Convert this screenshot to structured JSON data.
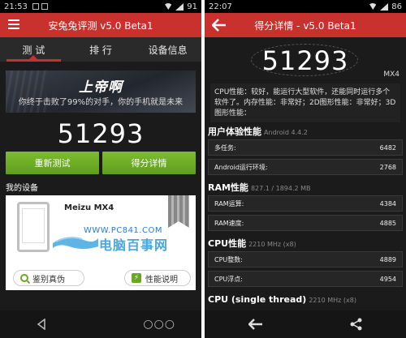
{
  "left": {
    "status": {
      "time": "21:53",
      "battery": "91"
    },
    "title": "安兔兔评测 v5.0 Beta1",
    "tabs": [
      "测 试",
      "排 行",
      "设备信息"
    ],
    "banner_title": "上帝啊",
    "banner_sub": "你终于击败了99%的对手，你的手机就是未来",
    "score": "51293",
    "retest_label": "重新测试",
    "details_label": "得分详情",
    "my_device_label": "我的设备",
    "device_name": "Meizu MX4",
    "watermark_url": "WWW.PC841.COM",
    "watermark_text": "电脑百事网",
    "verify_label": "鉴别真伪",
    "perf_label": "性能说明",
    "nav_dots": "○○○"
  },
  "right": {
    "status": {
      "time": "22:07",
      "battery": "86"
    },
    "title": "得分详情 - v5.0 Beta1",
    "score": "51293",
    "model": "MX4",
    "summary": "CPU性能：较好，能运行大型软件，还能同时运行多个软件了。内存性能：非常好；2D图形性能：非常好；3D图形性能：",
    "sections": [
      {
        "title": "用户体验性能",
        "sub": "Android 4.4.2",
        "rows": [
          {
            "label": "多任务:",
            "value": "6482"
          },
          {
            "label": "Android运行环境:",
            "value": "2768"
          }
        ]
      },
      {
        "title": "RAM性能",
        "sub": "827.1 / 1894.2 MB",
        "rows": [
          {
            "label": "RAM运算:",
            "value": "4384"
          },
          {
            "label": "RAM速度:",
            "value": "4885"
          }
        ]
      },
      {
        "title": "CPU性能",
        "sub": "2210 MHz (x8)",
        "rows": [
          {
            "label": "CPU整数:",
            "value": "4889"
          },
          {
            "label": "CPU浮点:",
            "value": "4954"
          }
        ]
      },
      {
        "title": "CPU (single thread)",
        "sub": "2210 MHz (x8)",
        "rows": []
      }
    ]
  },
  "colors": {
    "accent": "#c8312d",
    "green": "#6aa52a",
    "bg": "#1b1b1b"
  }
}
